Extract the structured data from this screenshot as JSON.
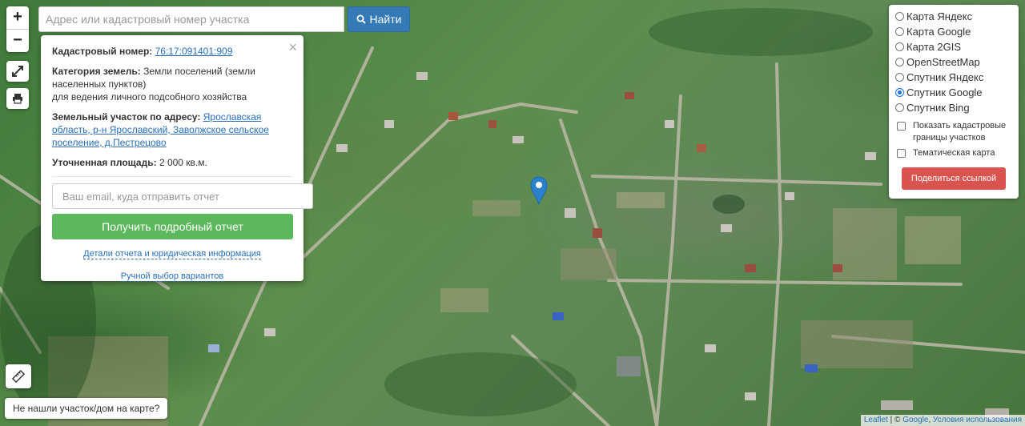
{
  "map": {
    "zoom_in": "+",
    "zoom_out": "−"
  },
  "search": {
    "placeholder": "Адрес или кадастровый номер участка",
    "button_label": "Найти"
  },
  "popup": {
    "cadastral_label": "Кадастровый номер:",
    "cadastral_number": "76:17:091401:909",
    "category_label": "Категория земель:",
    "category_value_1": "Земли поселений (земли населенных пунктов)",
    "category_value_2": "для ведения личного подсобного хозяйства",
    "address_label": "Земельный участок по адресу:",
    "address_value": "Ярославская область, р-н Ярославский, Заволжское сельское поселение, д.Пестрецово",
    "area_label": "Уточненная площадь:",
    "area_value": "2 000 кв.м.",
    "email_placeholder": "Ваш email, куда отправить отчет",
    "report_button": "Получить подробный отчет",
    "details_link": "Детали отчета и юридическая информация",
    "manual_link": "Ручной выбор вариантов",
    "close": "×"
  },
  "layers": {
    "options": [
      {
        "label": "Карта Яндекс",
        "selected": false
      },
      {
        "label": "Карта Google",
        "selected": false
      },
      {
        "label": "Карта 2GIS",
        "selected": false
      },
      {
        "label": "OpenStreetMap",
        "selected": false
      },
      {
        "label": "Спутник Яндекс",
        "selected": false
      },
      {
        "label": "Спутник Google",
        "selected": true
      },
      {
        "label": "Спутник Bing",
        "selected": false
      }
    ],
    "show_cadastral": "Показать кадастровые границы участков",
    "thematic": "Тематическая карта",
    "share_button": "Поделиться ссылкой"
  },
  "bottom": {
    "not_found": "Не нашли участок/дом на карте?"
  },
  "attribution": {
    "leaflet": "Leaflet",
    "sep": " | © ",
    "google": "Google",
    "comma": ", ",
    "terms": "Условия использования"
  },
  "colors": {
    "accent_blue": "#337ab7",
    "green_button": "#5cb85c",
    "red_button": "#d9534f",
    "marker": "#2a81cb"
  }
}
